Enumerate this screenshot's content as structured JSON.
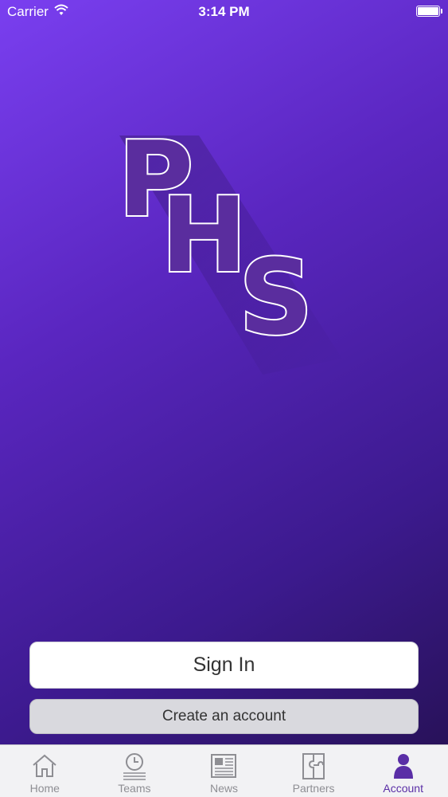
{
  "status_bar": {
    "carrier": "Carrier",
    "time": "3:14 PM"
  },
  "logo": {
    "letters": [
      "P",
      "H",
      "S"
    ],
    "fill_color": "#5a2d9e",
    "outline_color": "#ffffff"
  },
  "actions": {
    "sign_in_label": "Sign In",
    "create_account_label": "Create an account"
  },
  "tab_bar": {
    "active_color": "#5a2ea6",
    "inactive_color": "#8e8e93",
    "tabs": [
      {
        "label": "Home",
        "icon": "house-icon"
      },
      {
        "label": "Teams",
        "icon": "clock-list-icon"
      },
      {
        "label": "News",
        "icon": "newspaper-icon"
      },
      {
        "label": "Partners",
        "icon": "puzzle-piece-icon"
      },
      {
        "label": "Account",
        "icon": "person-icon",
        "active": true
      }
    ]
  }
}
